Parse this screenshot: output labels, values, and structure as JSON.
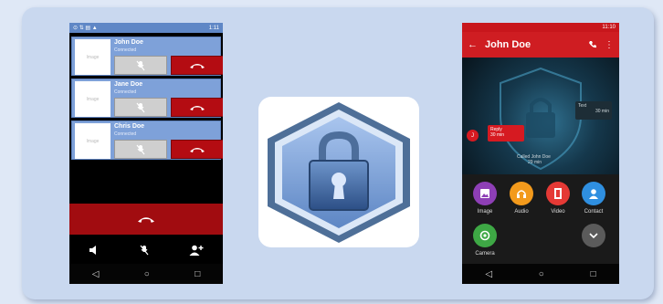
{
  "left_phone": {
    "status_time": "1:11",
    "calls": [
      {
        "name": "John Doe",
        "status": "Connected",
        "avatar_text": "Image"
      },
      {
        "name": "Jane Doe",
        "status": "Connected",
        "avatar_text": "Image"
      },
      {
        "name": "Chris Doe",
        "status": "Connected",
        "avatar_text": "Image"
      }
    ]
  },
  "right_phone": {
    "status_time": "11:10",
    "contact_name": "John Doe",
    "incoming_bubble": {
      "text": "Reply",
      "meta": "30 min"
    },
    "outgoing_bubble": {
      "text": "Text",
      "meta": "30 min"
    },
    "avatar_letter": "J",
    "missed_call": "Called John Doe",
    "missed_call_time": "29 min",
    "attachments": [
      {
        "label": "Image",
        "color": "#8e3fb6",
        "icon": "image-icon"
      },
      {
        "label": "Audio",
        "color": "#f39a1c",
        "icon": "headphones-icon"
      },
      {
        "label": "Video",
        "color": "#e53935",
        "icon": "film-icon"
      },
      {
        "label": "Contact",
        "color": "#2f8fe0",
        "icon": "contact-icon"
      },
      {
        "label": "Camera",
        "color": "#3ea845",
        "icon": "camera-icon"
      }
    ]
  },
  "colors": {
    "accent_red": "#cf1d22",
    "call_blue": "#7ea1d9",
    "card_bg": "#c9d8ef"
  }
}
